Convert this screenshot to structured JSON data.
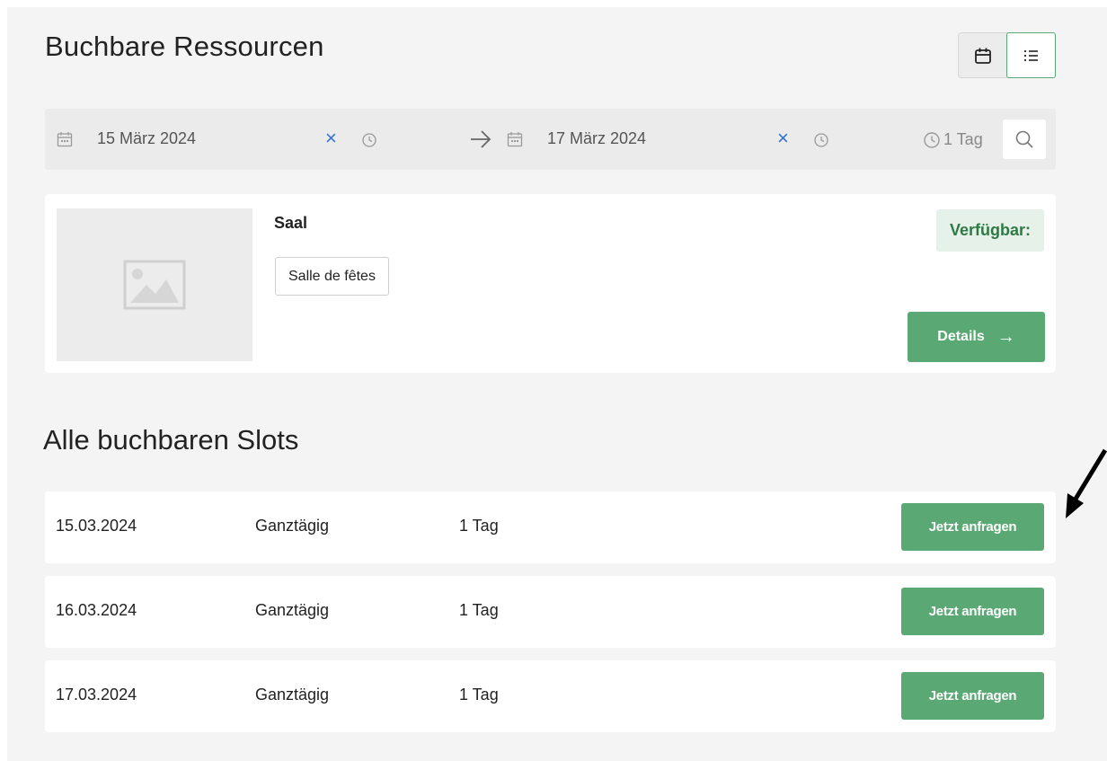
{
  "header": {
    "title": "Buchbare Ressourcen"
  },
  "view_toggle": {
    "calendar_icon": "calendar-icon",
    "list_icon": "list-icon",
    "active": "list"
  },
  "filter": {
    "start_date": "15 März 2024",
    "end_date": "17 März 2024",
    "duration": "1 Tag",
    "clear_symbol": "×"
  },
  "resource": {
    "name": "Saal",
    "tag": "Salle de fêtes",
    "availability": "Verfügbar:",
    "details_label": "Details",
    "details_arrow": "→"
  },
  "slots": {
    "title": "Alle buchbaren Slots",
    "button_label": "Jetzt anfragen",
    "rows": [
      {
        "date": "15.03.2024",
        "type": "Ganztägig",
        "duration": "1 Tag"
      },
      {
        "date": "16.03.2024",
        "type": "Ganztägig",
        "duration": "1 Tag"
      },
      {
        "date": "17.03.2024",
        "type": "Ganztägig",
        "duration": "1 Tag"
      }
    ]
  },
  "colors": {
    "accent": "#5aa873",
    "available_text": "#2e7a45",
    "clear_icon": "#2f6fd6"
  }
}
